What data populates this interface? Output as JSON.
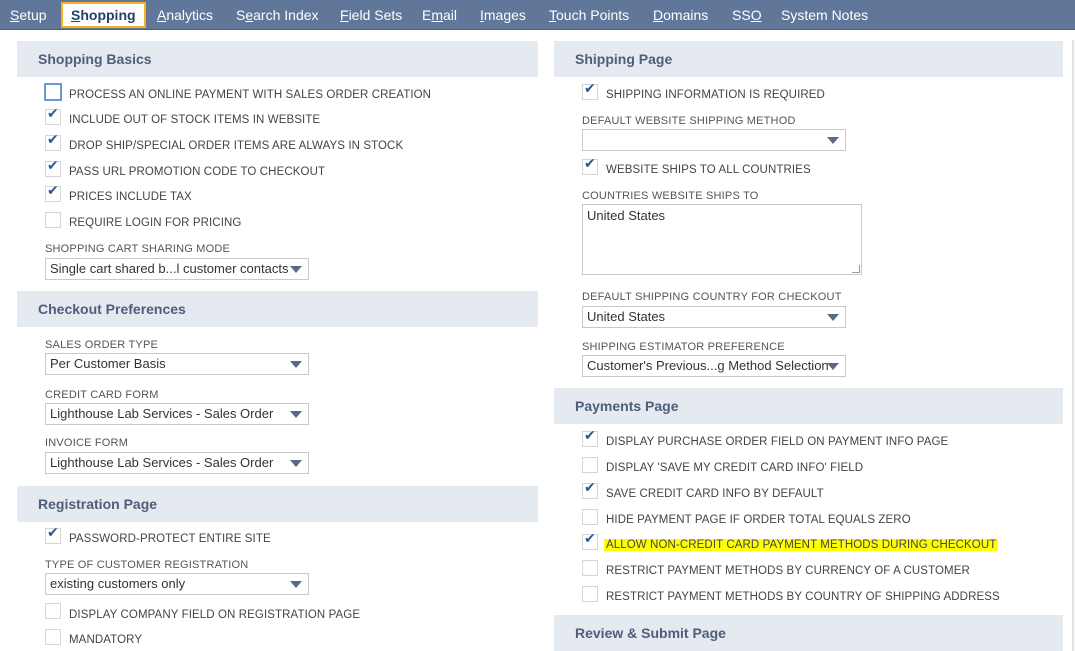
{
  "tabs": [
    {
      "pre": "",
      "acc": "S",
      "post": "etup"
    },
    {
      "pre": "",
      "acc": "S",
      "post": "hopping"
    },
    {
      "pre": "",
      "acc": "A",
      "post": "nalytics"
    },
    {
      "pre": "S",
      "acc": "e",
      "post": "arch Index"
    },
    {
      "pre": "",
      "acc": "F",
      "post": "ield Sets"
    },
    {
      "pre": "E",
      "acc": "m",
      "post": "ail"
    },
    {
      "pre": "",
      "acc": "I",
      "post": "mages"
    },
    {
      "pre": "",
      "acc": "T",
      "post": "ouch Points"
    },
    {
      "pre": "",
      "acc": "D",
      "post": "omains"
    },
    {
      "pre": "SS",
      "acc": "O",
      "post": ""
    },
    {
      "pre": "System Notes",
      "acc": "",
      "post": ""
    }
  ],
  "left": {
    "shopping_basics": {
      "title": "Shopping Basics",
      "checks": [
        {
          "label": "PROCESS AN ONLINE PAYMENT WITH SALES ORDER CREATION",
          "checked": false
        },
        {
          "label": "INCLUDE OUT OF STOCK ITEMS IN WEBSITE",
          "checked": true
        },
        {
          "label": "DROP SHIP/SPECIAL ORDER ITEMS ARE ALWAYS IN STOCK",
          "checked": true
        },
        {
          "label": "PASS URL PROMOTION CODE TO CHECKOUT",
          "checked": true
        },
        {
          "label": "PRICES INCLUDE TAX",
          "checked": true
        },
        {
          "label": "REQUIRE LOGIN FOR PRICING",
          "checked": false
        }
      ],
      "cart_mode_label": "SHOPPING CART SHARING MODE",
      "cart_mode_value": "Single cart shared b...l customer contacts"
    },
    "checkout": {
      "title": "Checkout Preferences",
      "sales_order_type_label": "SALES ORDER TYPE",
      "sales_order_type_value": "Per Customer Basis",
      "credit_card_form_label": "CREDIT CARD FORM",
      "credit_card_form_value": "Lighthouse Lab Services - Sales Order",
      "invoice_form_label": "INVOICE FORM",
      "invoice_form_value": "Lighthouse Lab Services - Sales Order"
    },
    "registration": {
      "title": "Registration Page",
      "password_protect": "PASSWORD-PROTECT ENTIRE SITE",
      "cust_reg_label": "TYPE OF CUSTOMER REGISTRATION",
      "cust_reg_value": "existing customers only",
      "company_field": "DISPLAY COMPANY FIELD ON REGISTRATION PAGE",
      "mandatory": "MANDATORY"
    }
  },
  "right": {
    "shipping": {
      "title": "Shipping Page",
      "ship_info_required": "SHIPPING INFORMATION IS REQUIRED",
      "default_method_label": "DEFAULT WEBSITE SHIPPING METHOD",
      "default_method_value": "",
      "ships_all": "WEBSITE SHIPS TO ALL COUNTRIES",
      "countries_label": "COUNTRIES WEBSITE SHIPS TO",
      "countries_value": "United States",
      "default_country_label": "DEFAULT SHIPPING COUNTRY FOR CHECKOUT",
      "default_country_value": "United States",
      "estimator_label": "SHIPPING ESTIMATOR PREFERENCE",
      "estimator_value": "Customer's Previous...g Method Selection"
    },
    "payments": {
      "title": "Payments Page",
      "checks": [
        {
          "label": "DISPLAY PURCHASE ORDER FIELD ON PAYMENT INFO PAGE",
          "checked": true
        },
        {
          "label": "DISPLAY 'SAVE MY CREDIT CARD INFO' FIELD",
          "checked": false
        },
        {
          "label": "SAVE CREDIT CARD INFO BY DEFAULT",
          "checked": true
        },
        {
          "label": "HIDE PAYMENT PAGE IF ORDER TOTAL EQUALS ZERO",
          "checked": false
        },
        {
          "label": "ALLOW NON-CREDIT CARD PAYMENT METHODS DURING CHECKOUT",
          "checked": true
        },
        {
          "label": "RESTRICT PAYMENT METHODS BY CURRENCY OF A CUSTOMER",
          "checked": false
        },
        {
          "label": "RESTRICT PAYMENT METHODS BY COUNTRY OF SHIPPING ADDRESS",
          "checked": false
        }
      ]
    },
    "review": {
      "title": "Review & Submit Page"
    }
  },
  "colors": {
    "tabbar": "#607799",
    "active_border": "#f5b324",
    "section_bg": "#e5e9f0",
    "highlight": "#ffff00",
    "check": "#2b5796"
  }
}
